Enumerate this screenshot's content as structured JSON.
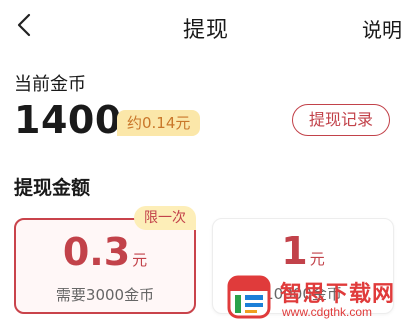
{
  "header": {
    "title": "提现",
    "help_label": "说明",
    "back_icon": "chevron-left-icon"
  },
  "coins": {
    "label": "当前金币",
    "value": "1400",
    "approx": "约0.14元",
    "record_button": "提现记录"
  },
  "amount_section": {
    "title": "提现金额"
  },
  "options": [
    {
      "amount": "0.3",
      "unit": "元",
      "cost": "需要3000金币",
      "badge": "限一次",
      "selected": true
    },
    {
      "amount": "1",
      "unit": "元",
      "cost": "10000金币",
      "selected": false
    }
  ],
  "watermark": {
    "logo": "site-logo",
    "text": "智思下载网",
    "url": "www.cdgthk.com"
  },
  "colors": {
    "accent": "#c2424a",
    "badge_bg": "#fbe7a9",
    "badge_text": "#c9772a",
    "selected_card_bg": "#fff7f7"
  }
}
